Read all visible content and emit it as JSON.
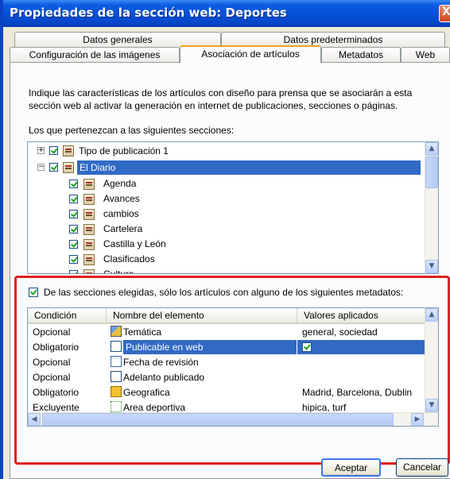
{
  "window": {
    "title": "Propiedades de la sección web: Deportes",
    "close_glyph": "X"
  },
  "tabs": {
    "row1": [
      "Datos generales",
      "Datos predeterminados"
    ],
    "row2": [
      "Configuración de las imágenes",
      "Asociación de artículos",
      "Metadatos",
      "Web"
    ]
  },
  "panel": {
    "intro_line1": "Indique las características de los artículos con diseño para prensa que se asociarán a esta",
    "intro_line2": "sección web al activar la generación en internet de publicaciones, secciones o páginas.",
    "sections_label": "Los que pertenezcan a las siguientes secciones:"
  },
  "tree": {
    "items": [
      {
        "label": "Tipo de publicación 1",
        "expander": "+",
        "checked": true
      },
      {
        "label": "El Diario",
        "expander": "−",
        "checked": true,
        "selected": true
      },
      {
        "label": "Agenda",
        "checked": true
      },
      {
        "label": "Avances",
        "checked": true
      },
      {
        "label": "cambios",
        "checked": true
      },
      {
        "label": "Cartelera",
        "checked": true
      },
      {
        "label": "Castilla y León",
        "checked": true
      },
      {
        "label": "Clasificados",
        "checked": true
      },
      {
        "label": "Cultura",
        "checked": true
      }
    ]
  },
  "metadata_filter": {
    "checkbox_label": "De las secciones elegidas, sólo los artículos con alguno de los siguientes metadatos:",
    "checked": true,
    "columns": [
      "Condición",
      "Nombre del elemento",
      "Valores aplicados"
    ],
    "rows": [
      {
        "condicion": "Opcional",
        "nombre": "Temática",
        "valores": "general, sociedad",
        "icon": "thematic-icon"
      },
      {
        "condicion": "Obligatorio",
        "nombre": "Publicable en web",
        "valores": "",
        "icon": "boolean-icon",
        "selected": true
      },
      {
        "condicion": "Opcional",
        "nombre": "Fecha de revisión",
        "valores": "",
        "icon": "date-icon"
      },
      {
        "condicion": "Opcional",
        "nombre": "Adelanto publicado",
        "valores": "",
        "icon": "boolean-icon"
      },
      {
        "condicion": "Obligatorio",
        "nombre": "Geografica",
        "valores": "Madrid, Barcelona, Dublin",
        "icon": "folder-icon"
      },
      {
        "condicion": "Excluyente",
        "nombre": "Area deportiva",
        "valores": "hipica, turf",
        "icon": "text-icon"
      }
    ]
  },
  "footer": {
    "accept": "Aceptar",
    "cancel": "Cancelar"
  }
}
